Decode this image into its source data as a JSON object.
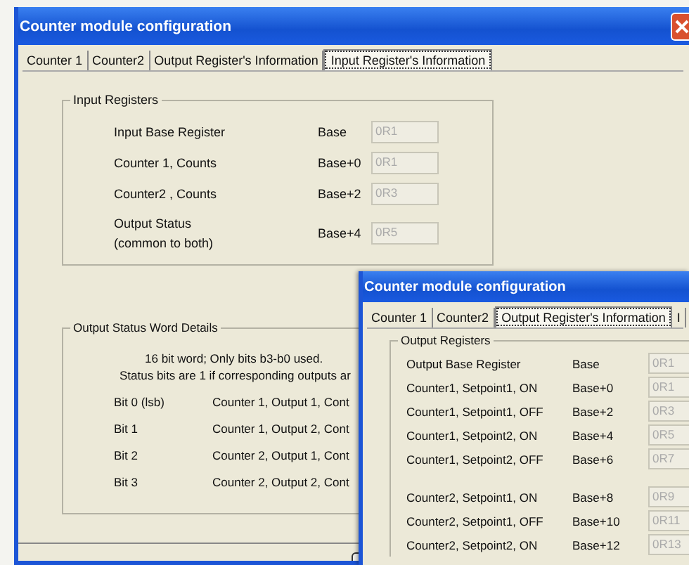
{
  "main_window": {
    "title": "Counter module configuration",
    "tabs": [
      {
        "label": "Counter 1",
        "selected": false
      },
      {
        "label": "Counter2",
        "selected": false
      },
      {
        "label": "Output Register's Information",
        "selected": false
      },
      {
        "label": "Input Register's Information",
        "selected": true
      }
    ],
    "input_registers": {
      "title": "Input Registers",
      "rows": [
        {
          "label": "Input Base Register",
          "offset": "Base",
          "value": "0R1",
          "disabled": true
        },
        {
          "label": "Counter 1, Counts",
          "offset": "Base+0",
          "value": "0R1",
          "disabled": true
        },
        {
          "label": "Counter2 , Counts",
          "offset": "Base+2",
          "value": "0R3",
          "disabled": true
        },
        {
          "label": "Output Status\n(common to both)",
          "offset": "Base+4",
          "value": "0R5",
          "disabled": true
        }
      ]
    },
    "output_status": {
      "title": "Output Status Word Details",
      "notes": [
        "16 bit word; Only bits b3-b0 used.",
        "Status bits are 1 if corresponding outputs ar"
      ],
      "bits": [
        {
          "bit": "Bit 0 (lsb)",
          "description": "Counter 1, Output 1, Cont"
        },
        {
          "bit": "Bit 1",
          "description": "Counter 1, Output 2, Cont"
        },
        {
          "bit": "Bit 2",
          "description": "Counter 2, Output 1, Cont"
        },
        {
          "bit": "Bit 3",
          "description": "Counter 2, Output 2, Cont"
        }
      ]
    }
  },
  "front_window": {
    "title": "Counter module configuration",
    "tabs": [
      {
        "label": "Counter 1",
        "selected": false
      },
      {
        "label": "Counter2",
        "selected": false
      },
      {
        "label": "Output Register's Information",
        "selected": true
      },
      {
        "label": "I",
        "selected": false
      }
    ],
    "output_registers": {
      "title": "Output Registers",
      "sections": [
        {
          "rows": [
            {
              "label": "Output Base Register",
              "offset": "Base",
              "value": "0R1",
              "disabled": true
            },
            {
              "label": "Counter1, Setpoint1, ON",
              "offset": "Base+0",
              "value": "0R1",
              "disabled": true
            },
            {
              "label": "Counter1, Setpoint1, OFF",
              "offset": "Base+2",
              "value": "0R3",
              "disabled": true
            },
            {
              "label": "Counter1, Setpoint2, ON",
              "offset": "Base+4",
              "value": "0R5",
              "disabled": true
            },
            {
              "label": "Counter1, Setpoint2, OFF",
              "offset": "Base+6",
              "value": "0R7",
              "disabled": true
            }
          ]
        },
        {
          "rows": [
            {
              "label": "Counter2, Setpoint1, ON",
              "offset": "Base+8",
              "value": "0R9",
              "disabled": true
            },
            {
              "label": "Counter2, Setpoint1, OFF",
              "offset": "Base+10",
              "value": "0R11",
              "disabled": true
            },
            {
              "label": "Counter2, Setpoint2, ON",
              "offset": "Base+12",
              "value": "0R13",
              "disabled": true
            }
          ]
        }
      ]
    }
  }
}
